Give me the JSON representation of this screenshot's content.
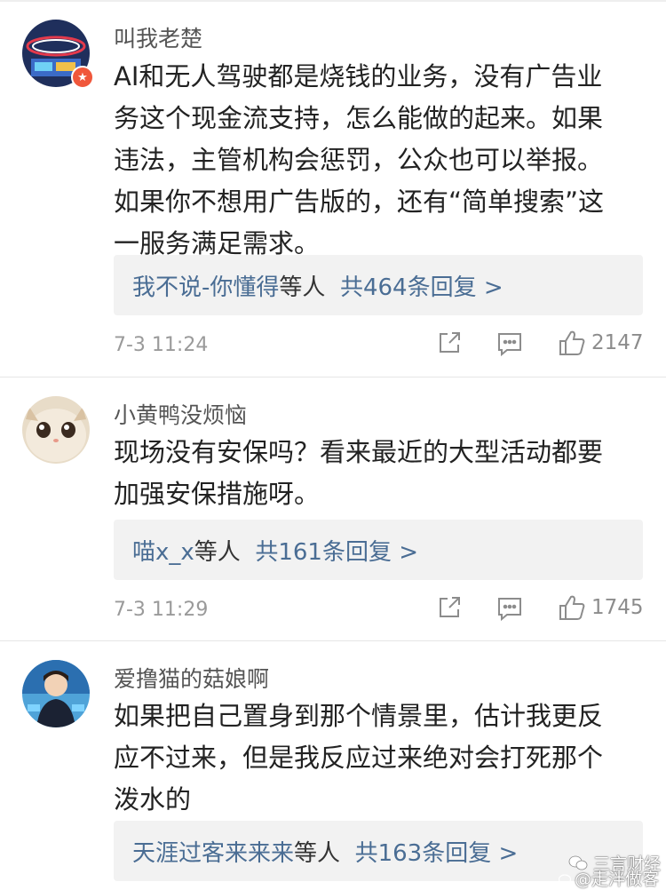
{
  "comments": [
    {
      "username": "叫我老楚",
      "lines": [
        "AI和无人驾驶都是烧钱的业务，没有广告业",
        "务这个现金流支持，怎么能做的起来。如果",
        "违法，主管机构会惩罚，公众也可以举报。",
        "如果你不想用广告版的，还有“简单搜索”这",
        "一服务满足需求。"
      ],
      "reply_users": "我不说-你懂得",
      "reply_suffix": "等人",
      "reply_count": "共464条回复 >",
      "time": "7-3 11:24",
      "likes": "2147"
    },
    {
      "username": "小黄鸭没烦恼",
      "lines": [
        "现场没有安保吗？看来最近的大型活动都要",
        "加强安保措施呀。"
      ],
      "reply_users": "喵x_x",
      "reply_suffix": "等人",
      "reply_count": "共161条回复 >",
      "time": "7-3 11:29",
      "likes": "1745"
    },
    {
      "username": "爱撸猫的菇娘啊",
      "lines": [
        "如果把自己置身到那个情景里，估计我更反",
        "应不过来，但是我反应过来绝对会打死那个",
        "泼水的"
      ],
      "reply_users": "天涯过客来来来",
      "reply_suffix": "等人",
      "reply_count": "共163条回复 >"
    }
  ],
  "watermark": {
    "wechat": "三言财经",
    "weibo": "@走泮做客"
  },
  "colors": {
    "link_blue": "#4a6d94",
    "reply_bg": "#f2f2f2",
    "meta_gray": "#9a9a9a"
  },
  "icons": [
    "share-icon",
    "comment-icon",
    "like-icon",
    "verified-badge-icon",
    "wechat-icon",
    "weibo-icon"
  ]
}
